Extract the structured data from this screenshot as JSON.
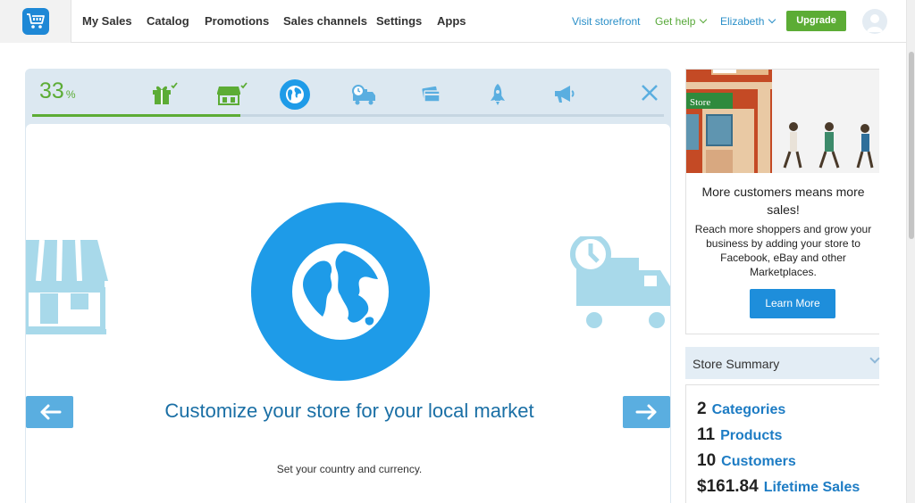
{
  "nav": {
    "items": [
      "My Sales",
      "Catalog",
      "Promotions",
      "Sales channels",
      "Settings",
      "Apps"
    ],
    "visit_storefront": "Visit storefront",
    "get_help": "Get help",
    "user": "Elizabeth",
    "upgrade": "Upgrade"
  },
  "wizard": {
    "progress_value": "33",
    "progress_unit": "%",
    "progress_fraction": 0.33,
    "steps": [
      {
        "icon": "gift-icon",
        "completed": true
      },
      {
        "icon": "storefront-icon",
        "completed": true
      },
      {
        "icon": "globe-icon",
        "active": true
      },
      {
        "icon": "delivery-truck-icon"
      },
      {
        "icon": "credit-card-icon"
      },
      {
        "icon": "rocket-icon"
      },
      {
        "icon": "megaphone-icon"
      }
    ],
    "title": "Customize your store for your local market",
    "subtitle": "Set your country and currency."
  },
  "promo": {
    "store_sign": "Store",
    "title": "More customers means more sales!",
    "body": "Reach more shoppers and grow your business by adding your store to Facebook, eBay and other Marketplaces.",
    "button": "Learn More"
  },
  "summary": {
    "header": "Store Summary",
    "stats": [
      {
        "value": "2",
        "label": "Categories"
      },
      {
        "value": "11",
        "label": "Products"
      },
      {
        "value": "10",
        "label": "Customers"
      },
      {
        "value": "$161.84",
        "label": "Lifetime Sales"
      }
    ]
  },
  "colors": {
    "green": "#5cac35",
    "blue": "#1e9be8",
    "light_blue": "#a8d9ea",
    "link_blue": "#1d7cc4"
  }
}
